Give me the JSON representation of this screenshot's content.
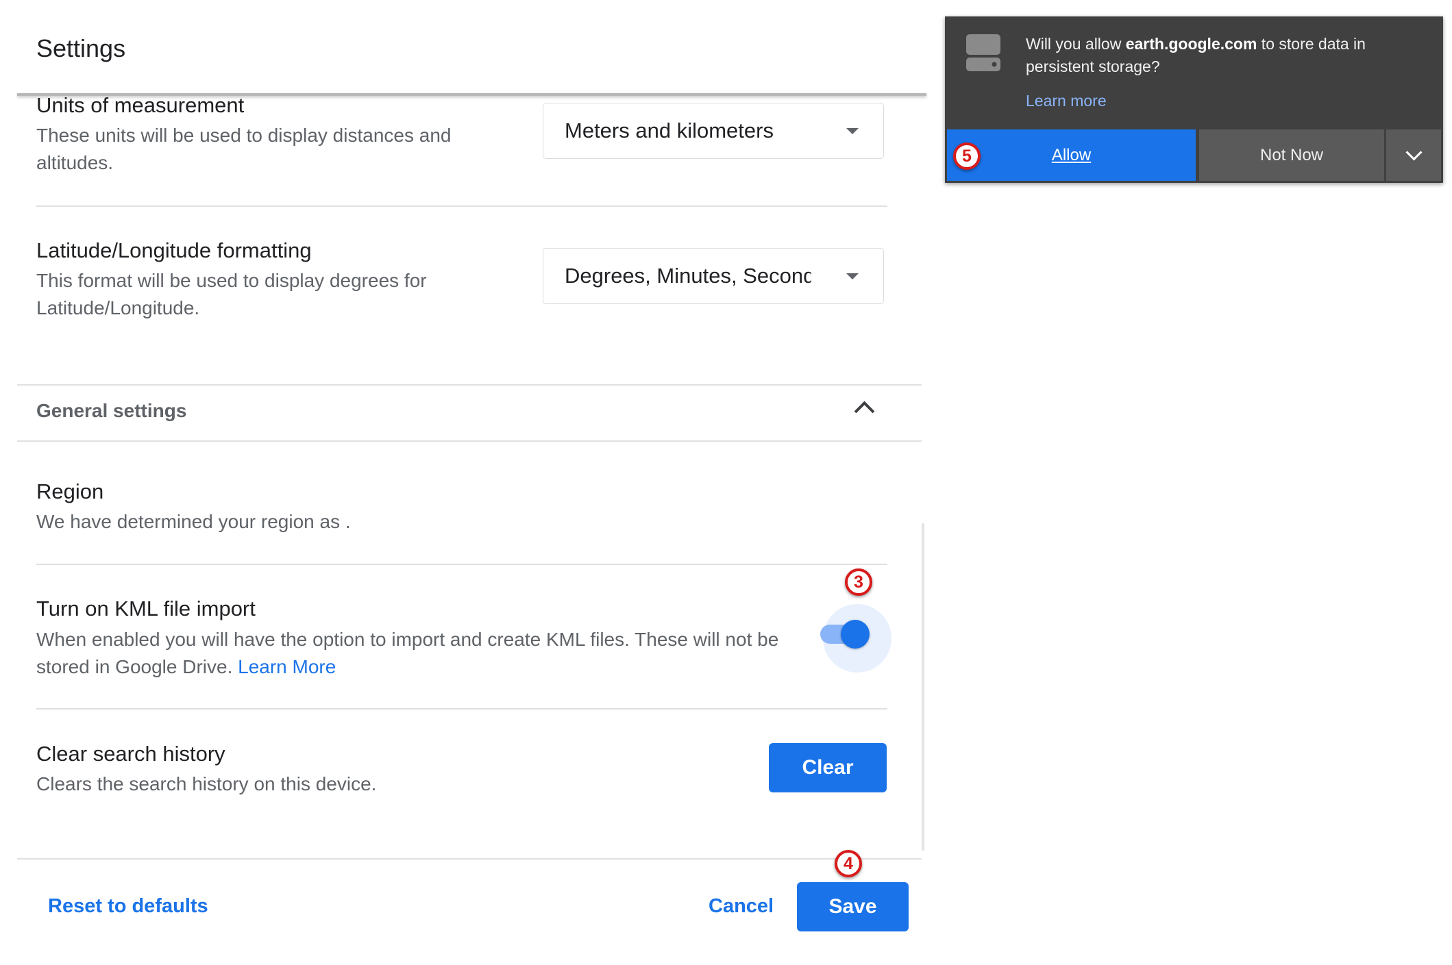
{
  "settings": {
    "title": "Settings",
    "units": {
      "title": "Units of measurement",
      "description": "These units will be used to display distances and altitudes.",
      "selected": "Meters and kilometers"
    },
    "latlng": {
      "title": "Latitude/Longitude formatting",
      "description": "This format will be used to display degrees for Latitude/Longitude.",
      "selected": "Degrees, Minutes, Seconds"
    },
    "general": {
      "section_title": "General settings",
      "expanded": true
    },
    "region": {
      "title": "Region",
      "description": "We have determined your region as ."
    },
    "kml": {
      "title": "Turn on KML file import",
      "description": "When enabled you will have the option to import and create KML files. These will not be stored in Google Drive.",
      "link": "Learn More",
      "enabled": true
    },
    "search_history": {
      "title": "Clear search history",
      "description": "Clears the search history on this device.",
      "button": "Clear"
    },
    "footer": {
      "reset": "Reset to defaults",
      "cancel": "Cancel",
      "save": "Save"
    }
  },
  "badges": {
    "toggle": "3",
    "save": "4",
    "allow": "5",
    "color": "#d81b1b"
  },
  "permission_popup": {
    "text_prefix": "Will you allow ",
    "domain": "earth.google.com",
    "text_suffix": " to store data in persistent storage?",
    "learn_more": "Learn more",
    "allow": "Allow",
    "not_now": "Not Now",
    "icon": "storage-drive-icon"
  },
  "colors": {
    "accent": "#1a73e8",
    "popup_bg": "#404040"
  }
}
